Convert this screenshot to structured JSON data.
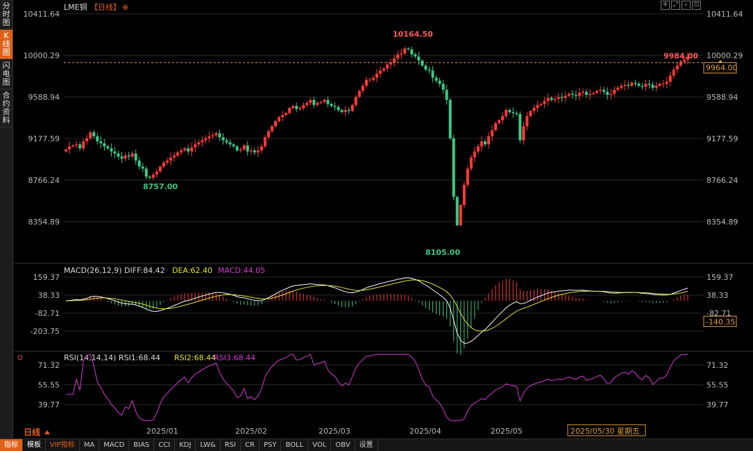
{
  "sidebar": {
    "items": [
      {
        "label": "分时图",
        "active": false
      },
      {
        "label": "K线图",
        "active": true
      },
      {
        "label": "闪电图",
        "active": false
      },
      {
        "label": "合约资料",
        "active": false
      }
    ]
  },
  "header": {
    "title": "LME铜",
    "period": "【日线】",
    "plus_symbol": "⊕"
  },
  "bottom_tabs": [
    {
      "label": "指标",
      "style": "active"
    },
    {
      "label": "模板",
      "style": "plain"
    },
    {
      "label": "VIP指标",
      "style": "vip"
    },
    {
      "label": "MA"
    },
    {
      "label": "MACD"
    },
    {
      "label": "BIAS"
    },
    {
      "label": "CCI"
    },
    {
      "label": "KDJ"
    },
    {
      "label": "LW&"
    },
    {
      "label": "RSI"
    },
    {
      "label": "CR"
    },
    {
      "label": "PSY"
    },
    {
      "label": "BOLL"
    },
    {
      "label": "VOL"
    },
    {
      "label": "OBV"
    },
    {
      "label": "设置"
    }
  ],
  "period_label": "日线",
  "chart_data": [
    {
      "type": "candlestick",
      "title": "LME铜【日线】",
      "y_ticks": [
        "10411.64",
        "10000.29",
        "9588.94",
        "9177.59",
        "8766.24",
        "8354.89"
      ],
      "ylim": [
        8354.89,
        10411.64
      ],
      "current_price": "9984.00",
      "right_price_label": "9964.00",
      "high_annotation": "10164.50",
      "low_annotations": [
        "8757.00",
        "8105.00"
      ],
      "x_labels": [
        "2025/01",
        "2025/02",
        "2025/03",
        "2025/04",
        "2025/05"
      ],
      "cursor_date": "2025/05/30 星期五",
      "up_color": "#ff3a3a",
      "down_color": "#3dc985",
      "price_path": [
        9070,
        9100,
        9110,
        9120,
        9080,
        9150,
        9180,
        9240,
        9200,
        9150,
        9130,
        9100,
        9080,
        9050,
        9030,
        9000,
        8980,
        9010,
        9000,
        9030,
        8960,
        8900,
        8880,
        8800,
        8790,
        8820,
        8850,
        8900,
        8940,
        8960,
        8990,
        9010,
        9040,
        9060,
        9080,
        9050,
        9090,
        9120,
        9140,
        9160,
        9180,
        9200,
        9210,
        9230,
        9190,
        9160,
        9140,
        9120,
        9100,
        9060,
        9070,
        9110,
        9050,
        9060,
        9040,
        9060,
        9100,
        9190,
        9250,
        9300,
        9350,
        9390,
        9410,
        9430,
        9480,
        9500,
        9470,
        9480,
        9510,
        9530,
        9560,
        9510,
        9530,
        9540,
        9560,
        9520,
        9500,
        9490,
        9460,
        9440,
        9460,
        9450,
        9510,
        9590,
        9650,
        9700,
        9760,
        9760,
        9780,
        9820,
        9850,
        9870,
        9910,
        9930,
        9970,
        10010,
        10020,
        10070,
        10060,
        10010,
        9990,
        9950,
        9900,
        9860,
        9850,
        9780,
        9750,
        9720,
        9660,
        9560,
        9180,
        8600,
        8320,
        8520,
        8720,
        8880,
        8990,
        9050,
        9100,
        9150,
        9120,
        9200,
        9260,
        9330,
        9360,
        9400,
        9460,
        9440,
        9430,
        9420,
        9160,
        9300,
        9400,
        9450,
        9480,
        9510,
        9520,
        9550,
        9580,
        9560,
        9570,
        9590,
        9580,
        9600,
        9620,
        9610,
        9600,
        9630,
        9640,
        9610,
        9620,
        9630,
        9650,
        9660,
        9640,
        9610,
        9620,
        9660,
        9680,
        9700,
        9710,
        9700,
        9730,
        9720,
        9700,
        9690,
        9720,
        9710,
        9680,
        9700,
        9720,
        9720,
        9740,
        9800,
        9860,
        9900,
        9940,
        9960,
        9984
      ],
      "macd": {
        "label": "MACD(26,12,9)",
        "diff": "DIFF:84.42",
        "dea": "DEA:62.40",
        "macd": "MACD:44.05",
        "y_ticks": [
          "159.37",
          "38.33",
          "-82.71",
          "-203.75"
        ],
        "ylim": [
          -203.75,
          159.37
        ],
        "right_value_label": "-140.35",
        "diff_color": "#ffffff",
        "dea_color": "#e6e63c",
        "macd_color": "#d63cd6"
      },
      "rsi": {
        "label": "RSI(14,14,14)",
        "rsi1": "RSI1:68.44",
        "rsi2": "RSI2:68.44",
        "rsi3": "RSI3:68.44",
        "y_ticks": [
          "71.32",
          "55.55",
          "39.77"
        ],
        "ylim": [
          39.77,
          71.32
        ],
        "line_color": "#d63cd6"
      }
    }
  ]
}
